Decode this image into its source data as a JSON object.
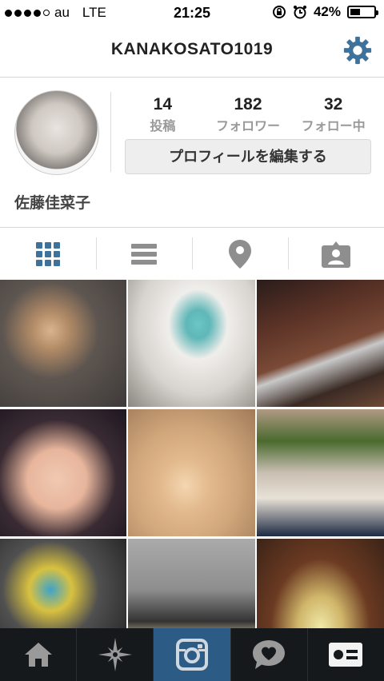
{
  "status": {
    "carrier": "au",
    "network": "LTE",
    "time": "21:25",
    "battery": "42%",
    "battery_level": 0.42
  },
  "header": {
    "title": "KANAKOSATO1019",
    "settings_icon": "gear-icon",
    "accent": "#3e729a"
  },
  "profile": {
    "stats": [
      {
        "num": "14",
        "label": "投稿"
      },
      {
        "num": "182",
        "label": "フォロワー"
      },
      {
        "num": "32",
        "label": "フォロー中"
      }
    ],
    "edit_label": "プロフィールを編集する",
    "full_name": "佐藤佳菜子"
  },
  "tabs": [
    {
      "icon": "grid-icon",
      "active": true
    },
    {
      "icon": "list-icon",
      "active": false
    },
    {
      "icon": "map-pin-icon",
      "active": false
    },
    {
      "icon": "tagged-photo-icon",
      "active": false
    }
  ],
  "nav": [
    {
      "icon": "home-icon"
    },
    {
      "icon": "explore-icon"
    },
    {
      "icon": "camera-icon",
      "active": true
    },
    {
      "icon": "activity-heart-icon"
    },
    {
      "icon": "profile-card-icon"
    }
  ]
}
